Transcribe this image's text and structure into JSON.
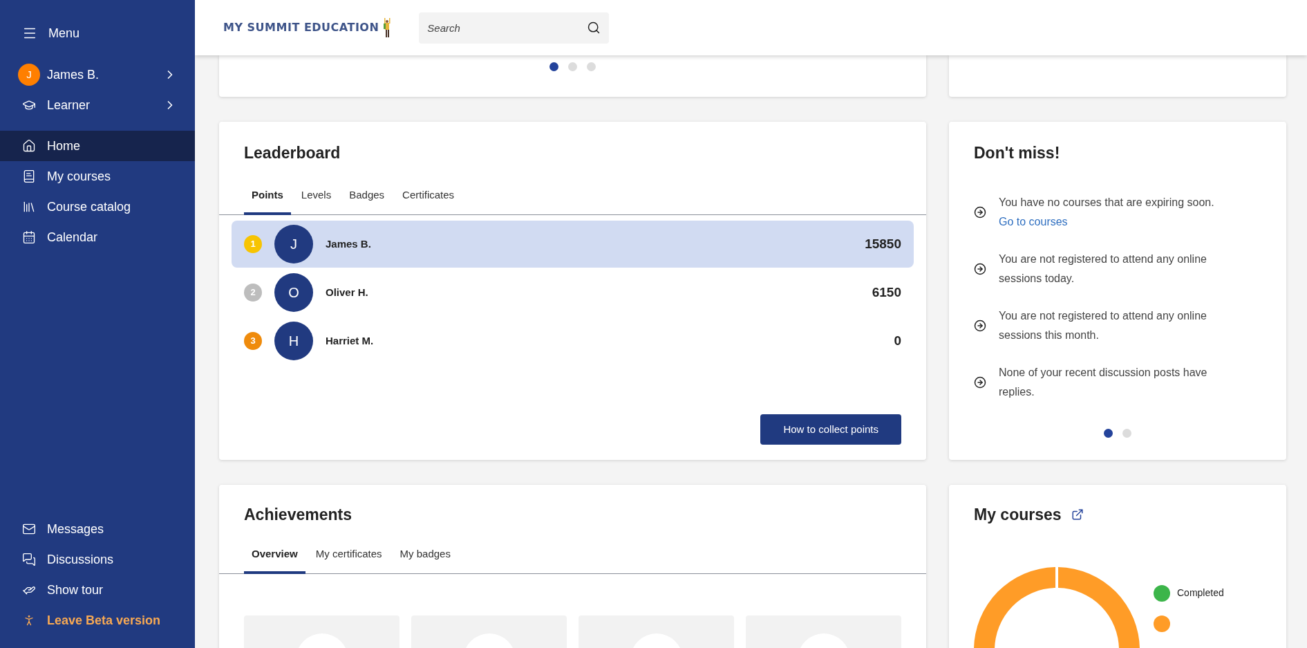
{
  "sidebar": {
    "menu_label": "Menu",
    "user": {
      "initial": "J",
      "name": "James B."
    },
    "role": "Learner",
    "nav": [
      {
        "label": "Home",
        "selected": true
      },
      {
        "label": "My courses",
        "selected": false
      },
      {
        "label": "Course catalog",
        "selected": false
      },
      {
        "label": "Calendar",
        "selected": false
      }
    ],
    "bottom_items": [
      {
        "label": "Messages",
        "kind": "link"
      },
      {
        "label": "Discussions",
        "kind": "link"
      },
      {
        "label": "Show tour",
        "kind": "link"
      },
      {
        "label": "Leave Beta version",
        "kind": "highlight"
      }
    ]
  },
  "header": {
    "logo": "MY SUMMIT EDUCATION",
    "search": {
      "placeholder": "Search"
    }
  },
  "top_carousel": {
    "dots": [
      {
        "selected": true
      },
      {
        "selected": false
      },
      {
        "selected": false
      }
    ]
  },
  "leaderboard": {
    "title": "Leaderboard",
    "tabs": [
      {
        "label": "Points",
        "selected": true
      },
      {
        "label": "Levels",
        "selected": false
      },
      {
        "label": "Badges",
        "selected": false
      },
      {
        "label": "Certificates",
        "selected": false
      }
    ],
    "rows": [
      {
        "rank": "1",
        "color": "#f7c402",
        "initial": "J",
        "name": "James B.",
        "points": "15850",
        "selected": true
      },
      {
        "rank": "2",
        "color": "#bdbdbd",
        "initial": "O",
        "name": "Oliver H.",
        "points": "6150",
        "selected": false
      },
      {
        "rank": "3",
        "color": "#ef8b0c",
        "initial": "H",
        "name": "Harriet M.",
        "points": "0",
        "selected": false
      }
    ],
    "button": "How to collect points"
  },
  "dont_miss": {
    "title": "Don't miss!",
    "items": [
      {
        "text": "You have no courses that are expiring soon.",
        "link": "Go to courses"
      },
      {
        "text": "You are not registered to attend any online sessions today."
      },
      {
        "text": "You are not registered to attend any online sessions this month."
      },
      {
        "text": "None of your recent discussion posts have replies."
      }
    ],
    "dots": [
      {
        "selected": true
      },
      {
        "selected": false
      }
    ]
  },
  "achievements": {
    "title": "Achievements",
    "tabs": [
      {
        "label": "Overview",
        "selected": true
      },
      {
        "label": "My certificates",
        "selected": false
      },
      {
        "label": "My badges",
        "selected": false
      }
    ],
    "cards": [
      {
        "kind": "badge"
      },
      {
        "kind": "badge"
      },
      {
        "kind": "badge"
      },
      {
        "kind": "badge"
      }
    ]
  },
  "my_courses": {
    "title": "My courses",
    "legend": [
      {
        "label": "Completed",
        "color": "#3cb54a"
      },
      {
        "color": "#ff9c27"
      }
    ]
  }
}
